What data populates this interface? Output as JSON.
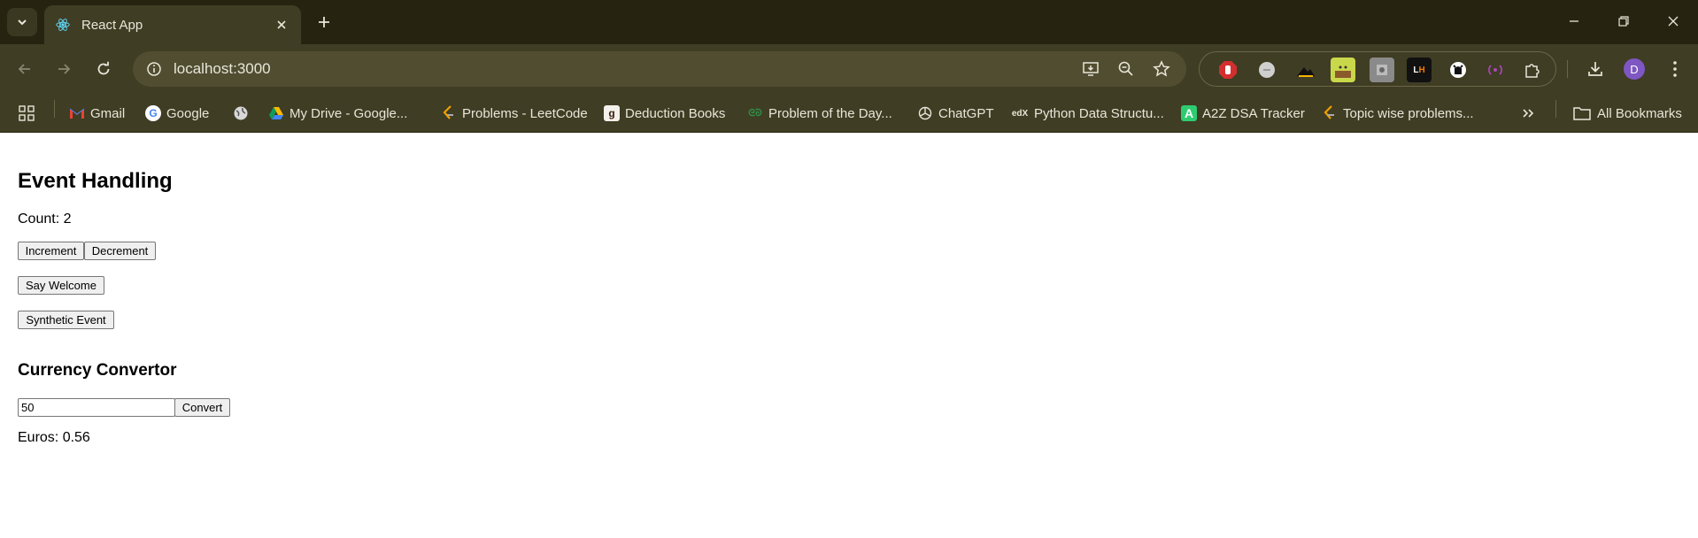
{
  "browser": {
    "tab_title": "React App",
    "url": "localhost:3000",
    "profile_initial": "D",
    "bookmarks": [
      {
        "label": "Gmail",
        "icon": "gmail-icon"
      },
      {
        "label": "Google",
        "icon": "google-icon"
      },
      {
        "label": "",
        "icon": "globe-icon"
      },
      {
        "label": "My Drive - Google...",
        "icon": "drive-icon"
      },
      {
        "label": "Problems - LeetCode",
        "icon": "leetcode-icon"
      },
      {
        "label": "Deduction Books",
        "icon": "goodreads-icon"
      },
      {
        "label": "Problem of the Day...",
        "icon": "gfg-icon"
      },
      {
        "label": "ChatGPT",
        "icon": "chatgpt-icon"
      },
      {
        "label": "Python Data Structu...",
        "icon": "edx-icon"
      },
      {
        "label": "A2Z DSA Tracker",
        "icon": "a2z-icon"
      },
      {
        "label": "Topic wise problems...",
        "icon": "leetcode-icon"
      }
    ],
    "all_bookmarks_label": "All Bookmarks"
  },
  "page": {
    "heading": "Event Handling",
    "count_text": "Count: 2",
    "increment_label": "Increment",
    "decrement_label": "Decrement",
    "say_welcome_label": "Say Welcome",
    "synthetic_event_label": "Synthetic Event",
    "currency_heading": "Currency Convertor",
    "amount_value": "50",
    "convert_label": "Convert",
    "euros_text": "Euros: 0.56"
  },
  "colors": {
    "chrome_frame": "#262410",
    "chrome_toolbar": "#3f3d24",
    "omnibox": "#504d31",
    "avatar": "#7e57c2"
  }
}
